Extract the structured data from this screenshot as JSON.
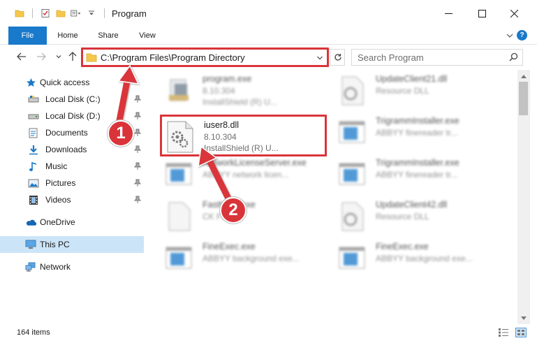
{
  "window": {
    "title": "Program",
    "controls": {
      "minimize": "minimize",
      "maximize": "maximize",
      "close": "close"
    }
  },
  "ribbon": {
    "tabs": [
      "File",
      "Home",
      "Share",
      "View"
    ],
    "help": "?"
  },
  "nav": {
    "address_path": "C:\\Program Files\\Program Directory",
    "search_placeholder": "Search Program"
  },
  "sidebar": {
    "items": [
      {
        "label": "Quick access",
        "icon": "star-icon",
        "pinned": false
      },
      {
        "label": "Local Disk (C:)",
        "icon": "drive-icon",
        "pinned": true
      },
      {
        "label": "Local Disk (D:)",
        "icon": "drive-icon",
        "pinned": true
      },
      {
        "label": "Documents",
        "icon": "documents-icon",
        "pinned": true
      },
      {
        "label": "Downloads",
        "icon": "downloads-icon",
        "pinned": true
      },
      {
        "label": "Music",
        "icon": "music-icon",
        "pinned": true
      },
      {
        "label": "Pictures",
        "icon": "pictures-icon",
        "pinned": true
      },
      {
        "label": "Videos",
        "icon": "videos-icon",
        "pinned": true
      },
      {
        "label": "OneDrive",
        "icon": "onedrive-icon",
        "pinned": false
      },
      {
        "label": "This PC",
        "icon": "pc-icon",
        "pinned": false,
        "selected": true
      },
      {
        "label": "Network",
        "icon": "network-icon",
        "pinned": false
      }
    ]
  },
  "files": [
    {
      "name": "program.exe",
      "line1": "8.10.304",
      "line2": "InstallShield (R) U...",
      "icon": "installer-icon",
      "blurred": true
    },
    {
      "name": "UpdateClient21.dll",
      "line1": "Resource DLL",
      "line2": "",
      "icon": "dll-icon",
      "blurred": true
    },
    {
      "name": "iuser8.dll",
      "line1": "8.10.304",
      "line2": "InstallShield (R) U...",
      "icon": "dll-gear-icon",
      "blurred": false
    },
    {
      "name": "TrigrammInstaller.exe",
      "line1": "ABBYY finereader tr...",
      "line2": "",
      "icon": "exe-window-icon",
      "blurred": true
    },
    {
      "name": "NetworkLicenseServer.exe",
      "line1": "ABBYY network licen...",
      "line2": "",
      "icon": "exe-window-icon",
      "blurred": true
    },
    {
      "name": "TrigrammInstaller.exe",
      "line1": "ABBYY finereader tr...",
      "line2": "",
      "icon": "exe-window-icon",
      "blurred": true
    },
    {
      "name": "FastKeys.exe",
      "line1": "CK Fast...",
      "line2": "",
      "icon": "file-icon",
      "blurred": true
    },
    {
      "name": "UpdateClient42.dll",
      "line1": "Resource DLL",
      "line2": "",
      "icon": "dll-icon",
      "blurred": true
    },
    {
      "name": "FineExec.exe",
      "line1": "ABBYY background exe...",
      "line2": "",
      "icon": "exe-window-icon",
      "blurred": true
    },
    {
      "name": "FineExec.exe",
      "line1": "ABBYY background exe...",
      "line2": "",
      "icon": "exe-window-icon",
      "blurred": true
    }
  ],
  "status": {
    "item_count": "164 items"
  },
  "annotations": {
    "step1": "1",
    "step2": "2"
  },
  "colors": {
    "accent": "#1979ca",
    "highlight": "#d9343a",
    "selected_bg": "#cce4f7"
  }
}
